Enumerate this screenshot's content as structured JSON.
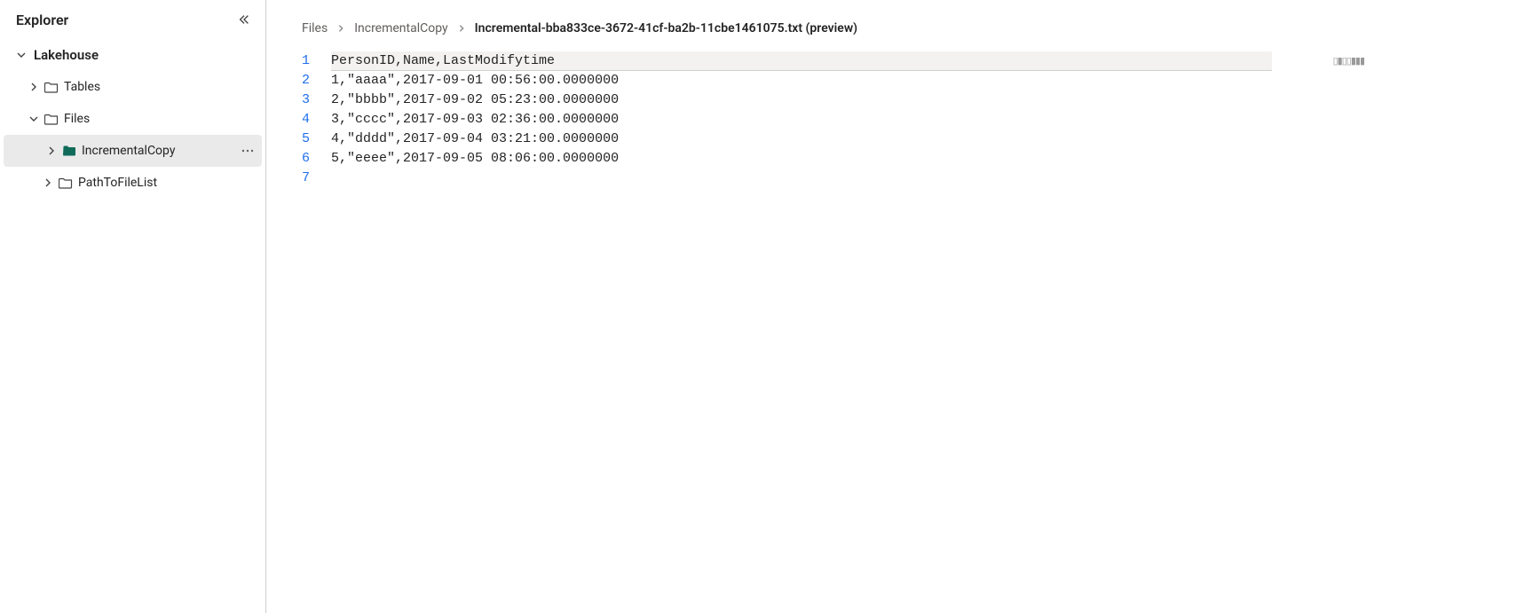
{
  "sidebar": {
    "title": "Explorer",
    "root": {
      "label": "Lakehouse"
    },
    "tables": {
      "label": "Tables"
    },
    "files": {
      "label": "Files"
    },
    "incremental": {
      "label": "IncrementalCopy"
    },
    "pathlist": {
      "label": "PathToFileList"
    }
  },
  "breadcrumb": {
    "items": [
      {
        "label": "Files"
      },
      {
        "label": "IncrementalCopy"
      },
      {
        "label": "Incremental-bba833ce-3672-41cf-ba2b-11cbe1461075.txt (preview)"
      }
    ]
  },
  "editor": {
    "lines": [
      "PersonID,Name,LastModifytime",
      "1,\"aaaa\",2017-09-01 00:56:00.0000000",
      "2,\"bbbb\",2017-09-02 05:23:00.0000000",
      "3,\"cccc\",2017-09-03 02:36:00.0000000",
      "4,\"dddd\",2017-09-04 03:21:00.0000000",
      "5,\"eeee\",2017-09-05 08:06:00.0000000",
      ""
    ]
  }
}
